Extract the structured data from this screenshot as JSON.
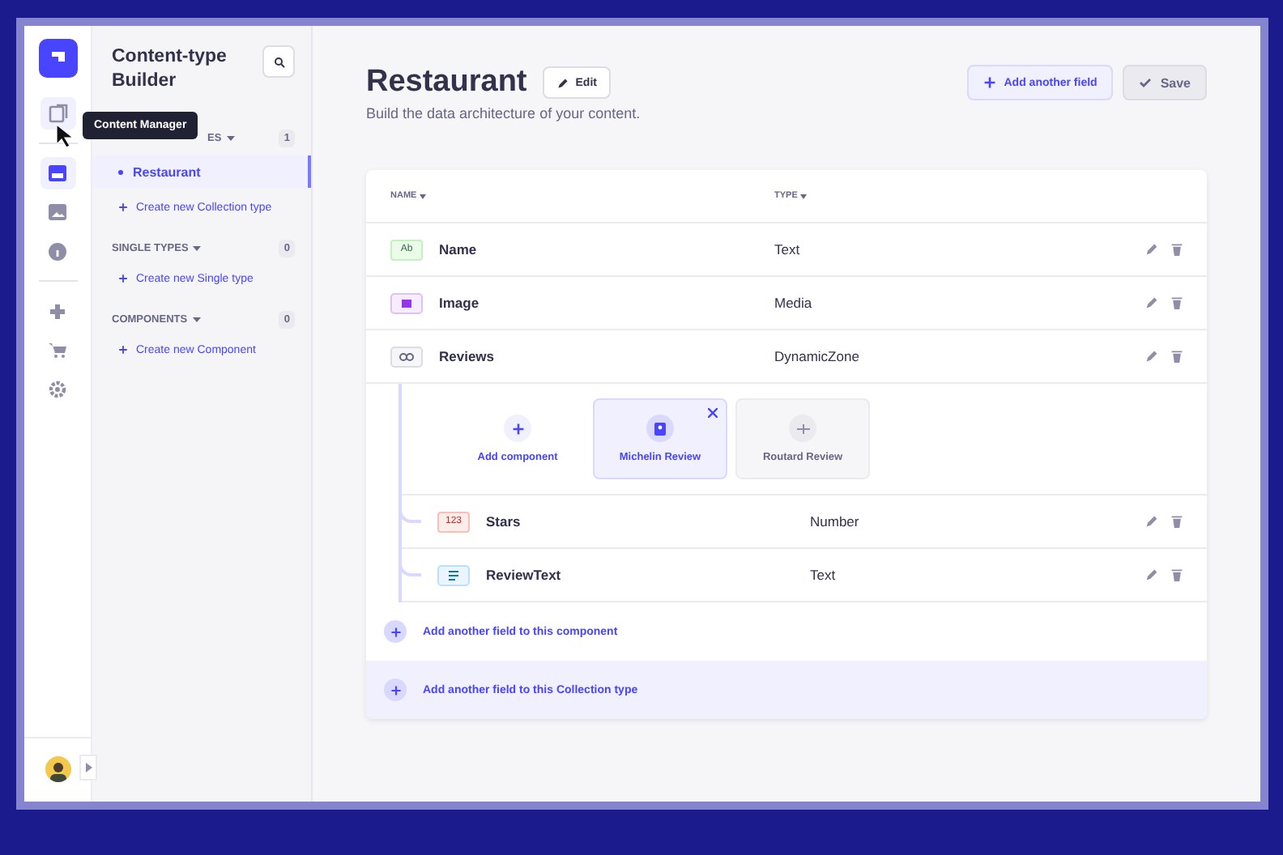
{
  "rail": {
    "items": [
      {
        "kind": "content",
        "selected": true
      },
      {
        "kind": "builder",
        "selected": true
      },
      {
        "kind": "media",
        "selected": false
      },
      {
        "kind": "info",
        "selected": false
      },
      {
        "kind": "plugins",
        "selected": false
      },
      {
        "kind": "cart",
        "selected": false
      },
      {
        "kind": "settings",
        "selected": false
      }
    ]
  },
  "tooltip": "Content Manager",
  "sidebar": {
    "title": "Content-type Builder",
    "sections": [
      {
        "title": "ES",
        "count": "1",
        "items": [
          {
            "label": "Restaurant",
            "selected": true
          }
        ],
        "create": "Create new Collection type"
      },
      {
        "title": "SINGLE TYPES",
        "count": "0",
        "create": "Create new Single type"
      },
      {
        "title": "COMPONENTS",
        "count": "0",
        "create": "Create new Component"
      }
    ]
  },
  "header": {
    "title": "Restaurant",
    "edit": "Edit",
    "subtitle": "Build the data architecture of your content.",
    "add_field": "Add another field",
    "save": "Save"
  },
  "table": {
    "columns": [
      "NAME",
      "TYPE"
    ],
    "rows": [
      {
        "kind": "text",
        "badge": "Ab",
        "name": "Name",
        "type": "Text"
      },
      {
        "kind": "media",
        "name": "Image",
        "type": "Media"
      },
      {
        "kind": "dynamiczone",
        "name": "Reviews",
        "type": "DynamicZone"
      }
    ],
    "components": [
      {
        "kind": "add",
        "label": "Add component",
        "selected": false
      },
      {
        "kind": "component",
        "label": "Michelin Review",
        "selected": true
      },
      {
        "kind": "component",
        "label": "Routard Review",
        "selected": false
      }
    ],
    "sub_rows": [
      {
        "kind": "number",
        "badge": "123",
        "name": "Stars",
        "type": "Number"
      },
      {
        "kind": "richtext",
        "name": "ReviewText",
        "type": "Text"
      }
    ],
    "add_sub": "Add another field to this component",
    "add_collection": "Add another field to this Collection type"
  }
}
